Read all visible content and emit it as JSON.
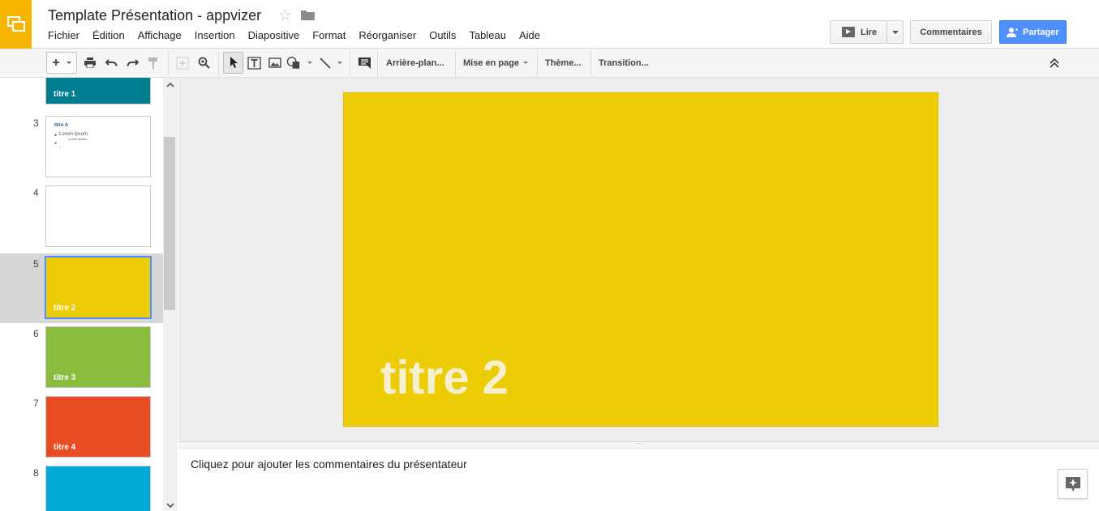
{
  "header": {
    "title": "Template Présentation - appvizer",
    "menu": [
      "Fichier",
      "Édition",
      "Affichage",
      "Insertion",
      "Diapositive",
      "Format",
      "Réorganiser",
      "Outils",
      "Tableau",
      "Aide"
    ],
    "present_label": "Lire",
    "comments_label": "Commentaires",
    "share_label": "Partager"
  },
  "toolbar": {
    "background_label": "Arrière-plan...",
    "layout_label": "Mise en page",
    "theme_label": "Thème...",
    "transition_label": "Transition..."
  },
  "colors": {
    "accent": "#4d90fe",
    "app_logo": "#f4b400",
    "current_slide": "#eccc05"
  },
  "slides": [
    {
      "number": "",
      "label": "titre 1",
      "color": "#007d8f"
    },
    {
      "number": "3",
      "label": "",
      "color": "#ffffff",
      "title": "titre A",
      "bullets": [
        "Lorem Ipsum",
        "Lorem Ipsum"
      ]
    },
    {
      "number": "4",
      "label": "",
      "color": "#ffffff"
    },
    {
      "number": "5",
      "label": "titre 2",
      "color": "#eccc05"
    },
    {
      "number": "6",
      "label": "titre 3",
      "color": "#8abd3e"
    },
    {
      "number": "7",
      "label": "titre 4",
      "color": "#e84c22"
    },
    {
      "number": "8",
      "label": "",
      "color": "#00aad4"
    }
  ],
  "current_slide": {
    "title": "titre 2"
  },
  "notes": {
    "placeholder": "Cliquez pour ajouter les commentaires du présentateur"
  }
}
